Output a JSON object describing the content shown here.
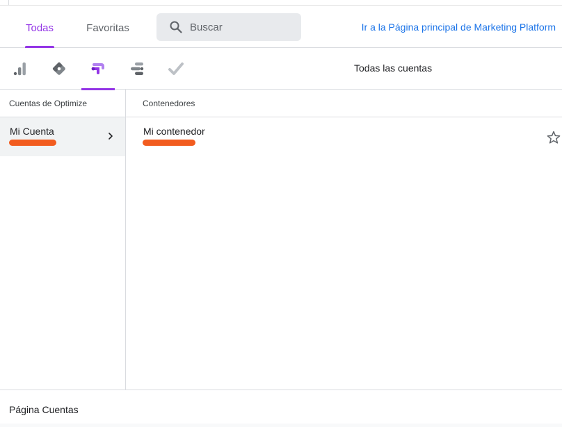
{
  "tabs": {
    "all_label": "Todas",
    "favorites_label": "Favoritas",
    "active": "Todas",
    "accent_color": "#9334e6"
  },
  "search": {
    "placeholder": "Buscar",
    "icon": "search-icon"
  },
  "marketing_platform_link": "Ir a la Página principal de Marketing Platform",
  "products": [
    {
      "icon": "analytics-icon",
      "selected": false
    },
    {
      "icon": "tag-manager-icon",
      "selected": false
    },
    {
      "icon": "optimize-icon",
      "selected": true
    },
    {
      "icon": "data-studio-icon",
      "selected": false
    },
    {
      "icon": "surveys-icon",
      "selected": false
    }
  ],
  "products_title": "Todas las cuentas",
  "accounts_column": {
    "header": "Cuentas de Optimize",
    "items": [
      {
        "name": "Mi Cuenta",
        "selected": true
      }
    ]
  },
  "containers_column": {
    "header": "Contenedores",
    "items": [
      {
        "name": "Mi contenedor",
        "favorite": false
      }
    ]
  },
  "footer": {
    "label": "Página Cuentas"
  },
  "colors": {
    "link": "#1a73e8",
    "redaction": "#f25c1f"
  }
}
